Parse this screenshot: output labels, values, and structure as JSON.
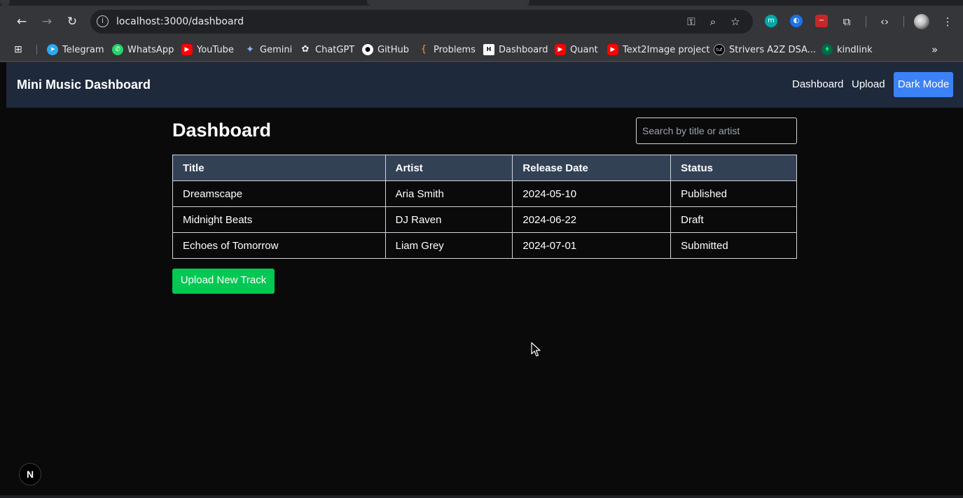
{
  "browser": {
    "url": "localhost:3000/dashboard",
    "bookmarks": [
      {
        "label": "Telegram",
        "icon": "telegram-icon",
        "color": "#2aabee"
      },
      {
        "label": "WhatsApp",
        "icon": "whatsapp-icon",
        "color": "#25d366"
      },
      {
        "label": "YouTube",
        "icon": "youtube-icon",
        "color": "#ff0000"
      },
      {
        "label": "Gemini",
        "icon": "gemini-icon",
        "color": "#8ab4f8"
      },
      {
        "label": "ChatGPT",
        "icon": "chatgpt-icon",
        "color": "#e8eaed"
      },
      {
        "label": "GitHub",
        "icon": "github-icon",
        "color": "#ffffff"
      },
      {
        "label": "Problems",
        "icon": "leetcode-icon",
        "color": "#ffa116"
      },
      {
        "label": "Dashboard",
        "icon": "dashboard-bookmark-icon",
        "color": "#ffffff"
      },
      {
        "label": "Quant",
        "icon": "youtube-icon",
        "color": "#ff0000"
      },
      {
        "label": "Text2Image project",
        "icon": "youtube-icon",
        "color": "#ff0000"
      },
      {
        "label": "Strivers A2Z DSA...",
        "icon": "tuf-icon",
        "color": "#000000"
      },
      {
        "label": "kindlink",
        "icon": "mongodb-icon",
        "color": "#00ed64"
      }
    ]
  },
  "app": {
    "brand": "Mini Music Dashboard",
    "nav": {
      "dashboard": "Dashboard",
      "upload": "Upload",
      "dark_mode": "Dark Mode"
    },
    "accent_color": "#3b82f6",
    "header_color": "#1e293b"
  },
  "dashboard": {
    "title": "Dashboard",
    "search_placeholder": "Search by title or artist",
    "columns": [
      "Title",
      "Artist",
      "Release Date",
      "Status"
    ],
    "rows": [
      [
        "Dreamscape",
        "Aria Smith",
        "2024-05-10",
        "Published"
      ],
      [
        "Midnight Beats",
        "DJ Raven",
        "2024-06-22",
        "Draft"
      ],
      [
        "Echoes of Tomorrow",
        "Liam Grey",
        "2024-07-01",
        "Submitted"
      ]
    ],
    "upload_button": "Upload New Track",
    "upload_color": "#00c853"
  },
  "dev_badge": "N"
}
